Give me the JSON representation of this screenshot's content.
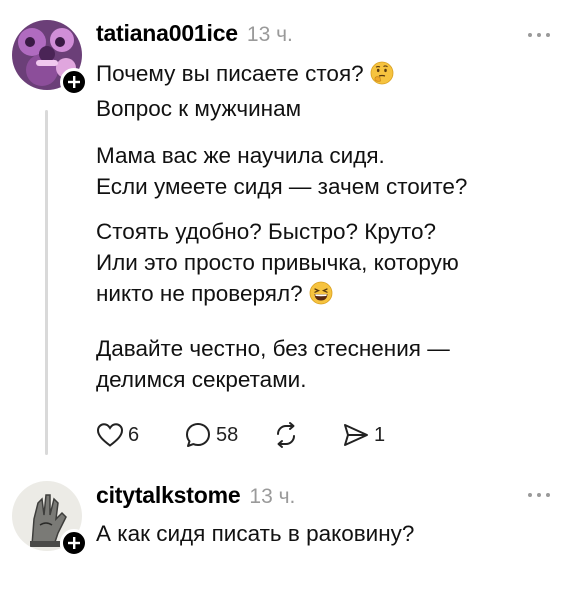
{
  "posts": [
    {
      "username": "tatiana001ice",
      "time": "13 ч.",
      "lines": [
        "Почему вы писаете стоя?",
        "Вопрос к мужчинам",
        "Мама вас же научила сидя.",
        "Если умеете сидя — зачем стоите?",
        "Стоять удобно? Быстро? Круто?",
        "Или это просто привычка, которую",
        "никто не проверял?",
        "Давайте честно, без стеснения —",
        "делимся секретами."
      ],
      "icons": {
        "emoji_1": "thinking-face-emoji",
        "emoji_2": "grinning-squinting-face-emoji"
      },
      "actions": {
        "likes": "6",
        "replies": "58",
        "reposts": "",
        "shares": "1"
      }
    },
    {
      "username": "citytalkstome",
      "time": "13 ч.",
      "lines": [
        "А как сидя писать в раковину?"
      ]
    }
  ],
  "colors": {
    "text": "#111111",
    "muted": "#9a9a9a",
    "thread_line": "#d9d9d9",
    "emoji": "#f6c33f"
  }
}
